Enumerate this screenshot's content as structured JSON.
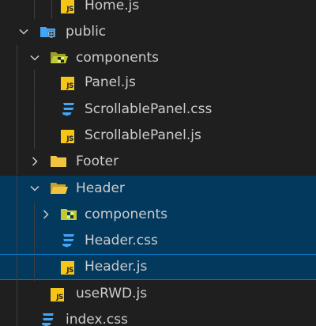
{
  "explorer": {
    "items": [
      {
        "label": "Home.js",
        "kind": "file",
        "file_type": "js",
        "icon": "js-file-icon"
      },
      {
        "label": "public",
        "kind": "folder",
        "expanded": true,
        "icon": "public-folder-icon"
      },
      {
        "label": "components",
        "kind": "folder",
        "expanded": true,
        "icon": "components-folder-icon"
      },
      {
        "label": "Panel.js",
        "kind": "file",
        "file_type": "js",
        "icon": "js-file-icon"
      },
      {
        "label": "ScrollablePanel.css",
        "kind": "file",
        "file_type": "css",
        "icon": "css-file-icon"
      },
      {
        "label": "ScrollablePanel.js",
        "kind": "file",
        "file_type": "js",
        "icon": "js-file-icon"
      },
      {
        "label": "Footer",
        "kind": "folder",
        "expanded": false,
        "icon": "folder-icon"
      },
      {
        "label": "Header",
        "kind": "folder",
        "expanded": true,
        "icon": "folder-open-icon"
      },
      {
        "label": "components",
        "kind": "folder",
        "expanded": false,
        "icon": "components-folder-icon"
      },
      {
        "label": "Header.css",
        "kind": "file",
        "file_type": "css",
        "icon": "css-file-icon"
      },
      {
        "label": "Header.js",
        "kind": "file",
        "file_type": "js",
        "icon": "js-file-icon",
        "selected": true
      },
      {
        "label": "useRWD.js",
        "kind": "file",
        "file_type": "js",
        "icon": "js-file-icon"
      },
      {
        "label": "index.css",
        "kind": "file",
        "file_type": "css",
        "icon": "css-file-icon"
      }
    ],
    "js_badge_text": "JS"
  },
  "colors": {
    "background": "#1f1f1f",
    "selection": "#04395e",
    "focus_border": "#0a7acb",
    "text": "#cccccc",
    "js_icon": "#f5c518",
    "css_icon": "#42a5f5",
    "folder": "#f0c43f",
    "components_folder": "#c0ca33",
    "public_folder": "#42a5f5"
  }
}
